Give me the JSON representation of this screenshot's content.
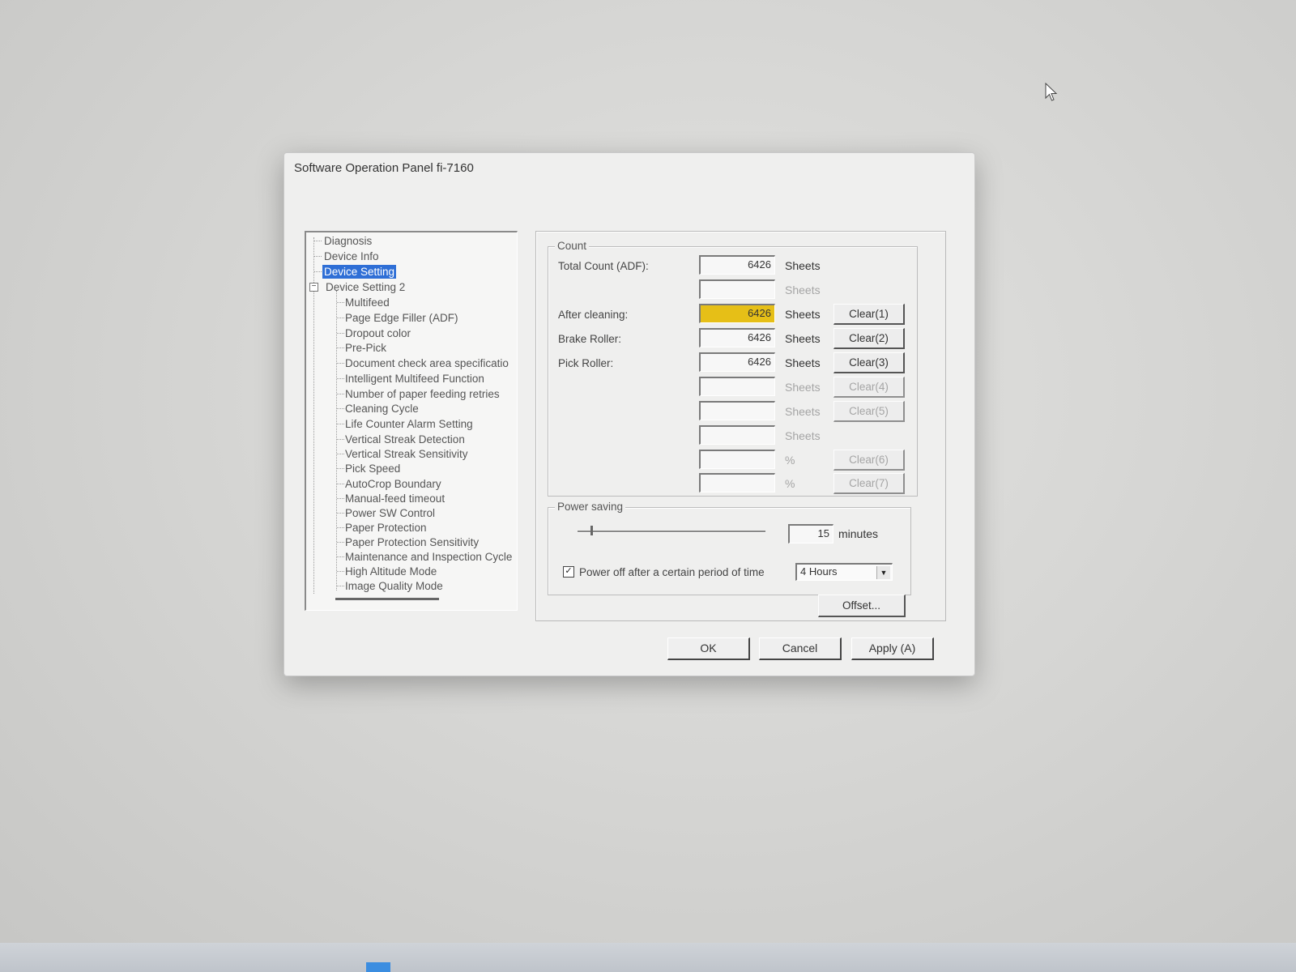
{
  "window": {
    "title": "Software Operation Panel fi-7160"
  },
  "tree": {
    "items": [
      {
        "label": "Diagnosis"
      },
      {
        "label": "Device Info"
      },
      {
        "label": "Device Setting"
      },
      {
        "label": "Device Setting 2"
      },
      {
        "label": "Multifeed"
      },
      {
        "label": "Page Edge Filler (ADF)"
      },
      {
        "label": "Dropout color"
      },
      {
        "label": "Pre-Pick"
      },
      {
        "label": "Document check area specificatio"
      },
      {
        "label": "Intelligent Multifeed Function"
      },
      {
        "label": "Number of paper feeding retries"
      },
      {
        "label": "Cleaning Cycle"
      },
      {
        "label": "Life Counter Alarm Setting"
      },
      {
        "label": "Vertical Streak Detection"
      },
      {
        "label": "Vertical Streak Sensitivity"
      },
      {
        "label": "Pick Speed"
      },
      {
        "label": "AutoCrop Boundary"
      },
      {
        "label": "Manual-feed timeout"
      },
      {
        "label": "Power SW Control"
      },
      {
        "label": "Paper Protection"
      },
      {
        "label": "Paper Protection Sensitivity"
      },
      {
        "label": "Maintenance and Inspection Cycle"
      },
      {
        "label": "High Altitude Mode"
      },
      {
        "label": "Image Quality Mode"
      }
    ],
    "selected": "Device Setting",
    "expander_symbol": "−"
  },
  "count": {
    "group_label": "Count",
    "rows": [
      {
        "label": "Total Count (ADF):",
        "value": "6426",
        "unit": "Sheets",
        "button": ""
      },
      {
        "label": "",
        "value": "",
        "unit": "Sheets",
        "button": ""
      },
      {
        "label": "After cleaning:",
        "value": "6426",
        "unit": "Sheets",
        "button": "Clear(1)"
      },
      {
        "label": "Brake Roller:",
        "value": "6426",
        "unit": "Sheets",
        "button": "Clear(2)"
      },
      {
        "label": "Pick Roller:",
        "value": "6426",
        "unit": "Sheets",
        "button": "Clear(3)"
      },
      {
        "label": "",
        "value": "",
        "unit": "Sheets",
        "button": "Clear(4)"
      },
      {
        "label": "",
        "value": "",
        "unit": "Sheets",
        "button": "Clear(5)"
      },
      {
        "label": "",
        "value": "",
        "unit": "Sheets",
        "button": ""
      },
      {
        "label": "",
        "value": "",
        "unit": "%",
        "button": "Clear(6)"
      },
      {
        "label": "",
        "value": "",
        "unit": "%",
        "button": "Clear(7)"
      }
    ],
    "highlight_color": "#e6bf17"
  },
  "power_saving": {
    "group_label": "Power saving",
    "minutes_value": "15",
    "minutes_unit": "minutes",
    "checkbox_checked": true,
    "checkbox_mark": "✓",
    "checkbox_label": "Power off after a certain period of time",
    "select_value": "4 Hours"
  },
  "buttons": {
    "offset": "Offset...",
    "ok": "OK",
    "cancel": "Cancel",
    "apply": "Apply (A)"
  },
  "colors": {
    "selection": "#2f6fd6",
    "taskbar_accent": "#3b8de0"
  }
}
